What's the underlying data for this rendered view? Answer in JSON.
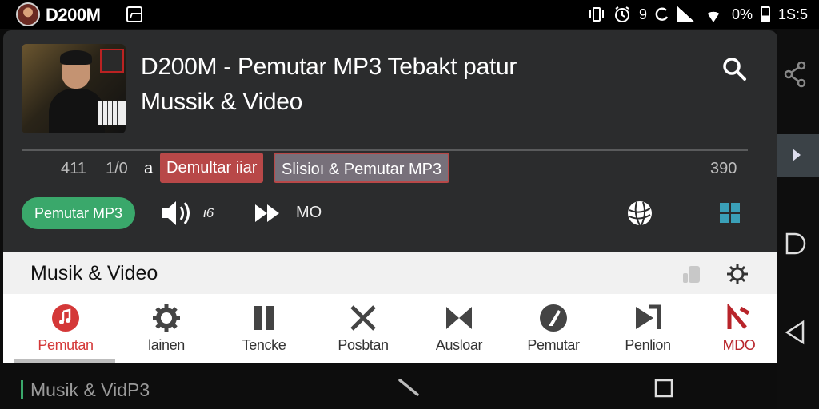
{
  "status_bar": {
    "app_name": "D200M",
    "indicators": "9",
    "battery": "0%",
    "time": "1S:5"
  },
  "player": {
    "title": "D200M - Pemutar MP3 Tebakt patur Mussik & Video",
    "time_left": "411",
    "time_mid": "1/0",
    "char": "a",
    "chip_primary": "Demultar iiar",
    "chip_secondary": "Slisioı & Pemutar MP3",
    "time_right": "390",
    "pill_label": "Pemutar MP3",
    "volume_label": "ι6",
    "mode_label": "MO"
  },
  "section": {
    "title": "Musik & Video"
  },
  "tabs": [
    {
      "label": "Pemutan",
      "icon": "music-note-icon",
      "active": true
    },
    {
      "label": "lainen",
      "icon": "gear-icon"
    },
    {
      "label": "Tencke",
      "icon": "pause-icon"
    },
    {
      "label": "Posbtan",
      "icon": "close-icon"
    },
    {
      "label": "Ausloar",
      "icon": "bowtie-icon"
    },
    {
      "label": "Pemutar",
      "icon": "disc-pen-icon"
    },
    {
      "label": "Penlion",
      "icon": "skip-next-icon"
    },
    {
      "label": "MDO",
      "icon": "mdo-logo-icon"
    }
  ],
  "bottom_bar": {
    "title": "Musik & VidP3"
  },
  "colors": {
    "accent_green": "#3aa86b",
    "accent_red": "#d43838",
    "card_bg": "#2b2c2d"
  }
}
